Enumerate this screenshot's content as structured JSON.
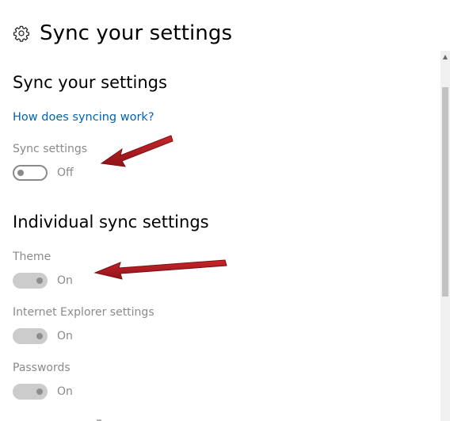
{
  "header": {
    "title": "Sync your settings",
    "icon": "gear-icon"
  },
  "sync_section": {
    "heading": "Sync your settings",
    "help_link": "How does syncing work?",
    "setting_label": "Sync settings",
    "toggle_state": "Off"
  },
  "individual_section": {
    "heading": "Individual sync settings",
    "items": [
      {
        "label": "Theme",
        "state": "On"
      },
      {
        "label": "Internet Explorer settings",
        "state": "On"
      },
      {
        "label": "Passwords",
        "state": "On"
      }
    ]
  },
  "colors": {
    "link": "#0063b1",
    "disabled_text": "#8a8a8a",
    "annotation_arrow": "#b01e23"
  }
}
